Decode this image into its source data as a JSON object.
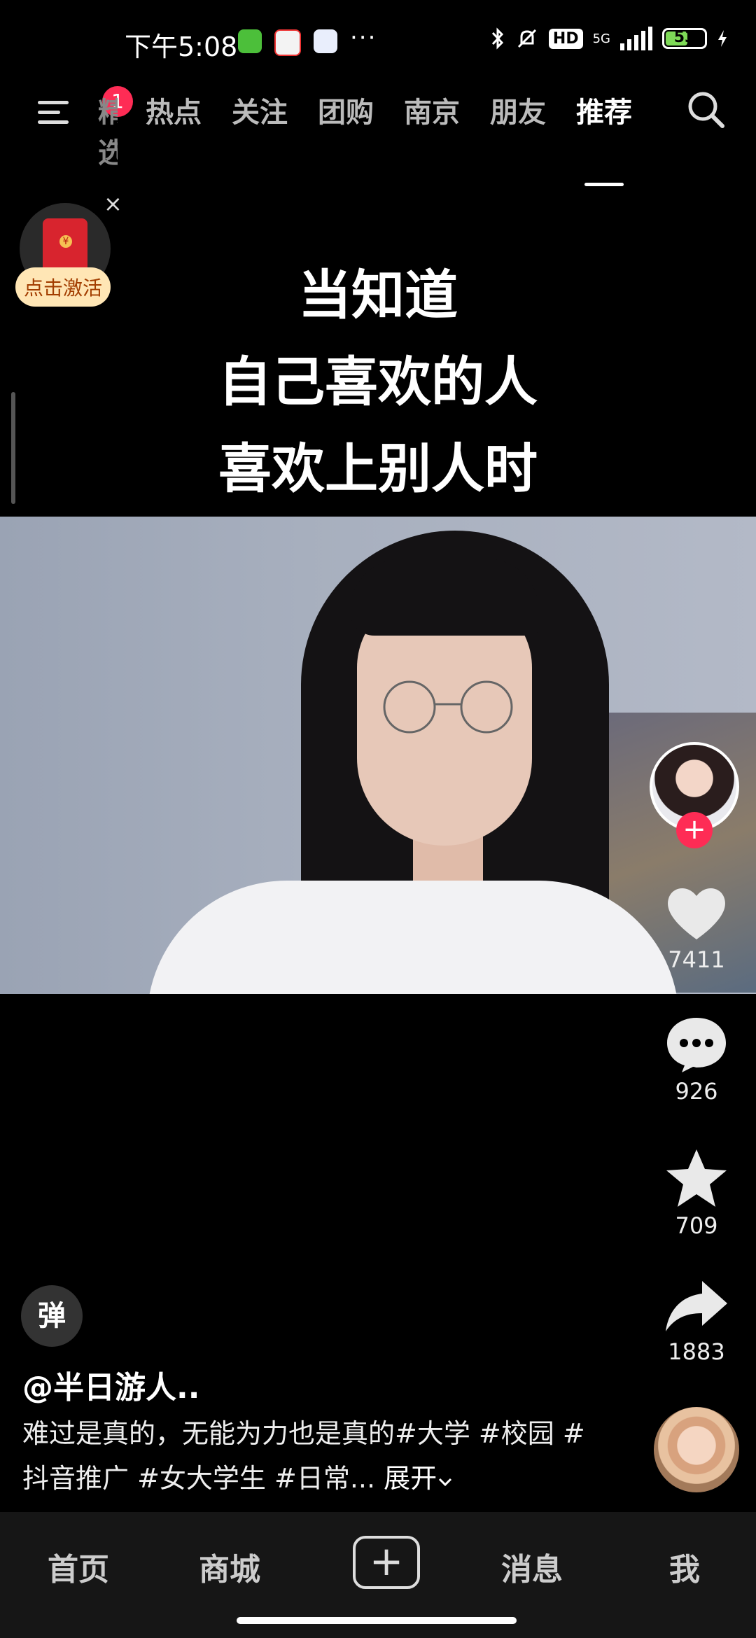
{
  "status_bar": {
    "time": "下午5:08",
    "network": "5G",
    "battery": "53"
  },
  "top_nav": {
    "notification_count": "1",
    "tabs": [
      {
        "label": "精选",
        "partial": true
      },
      {
        "label": "热点"
      },
      {
        "label": "关注"
      },
      {
        "label": "团购"
      },
      {
        "label": "南京"
      },
      {
        "label": "朋友"
      },
      {
        "label": "推荐",
        "active": true
      }
    ]
  },
  "red_packet": {
    "label": "点击激活"
  },
  "video": {
    "caption_lines": [
      "当知道",
      "自己喜欢的人",
      "喜欢上别人时"
    ]
  },
  "actions": {
    "likes": "7411",
    "comments": "926",
    "favorites": "709",
    "shares": "1883"
  },
  "post": {
    "danmu_label": "弹",
    "author": "@半日游人..",
    "description": "难过是真的，无能为力也是真的#大学 #校园 #抖音推广 #女大学生 #日常...",
    "expand_label": "展开"
  },
  "bottom_nav": {
    "items": [
      "首页",
      "商城",
      "消息",
      "我"
    ]
  },
  "colors": {
    "accent": "#fe2c55",
    "background": "#000000"
  }
}
